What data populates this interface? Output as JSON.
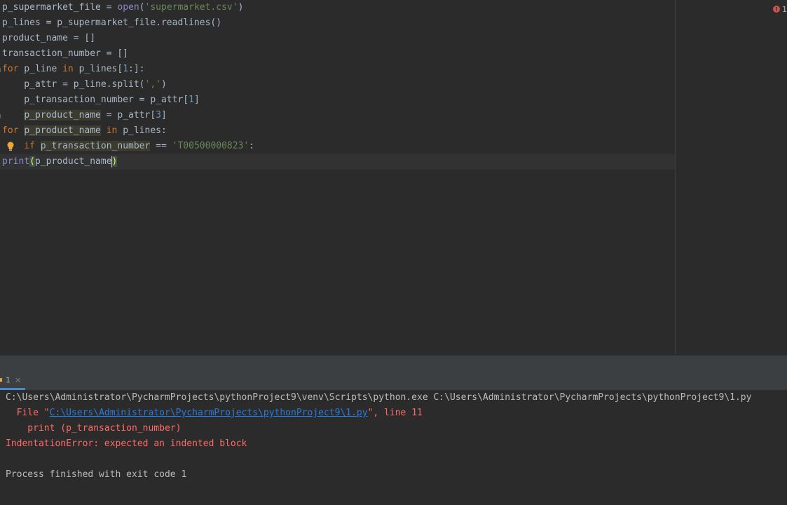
{
  "editor": {
    "error_count": "1",
    "lines": [
      [
        {
          "t": "p_supermarket_file = "
        },
        {
          "t": "open",
          "c": "builtin"
        },
        {
          "t": "("
        },
        {
          "t": "'supermarket.csv'",
          "c": "str"
        },
        {
          "t": ")"
        }
      ],
      [
        {
          "t": "p_lines = p_supermarket_file.readlines()"
        }
      ],
      [
        {
          "t": "product_name = []"
        }
      ],
      [
        {
          "t": "transaction_number = []"
        }
      ],
      [
        {
          "t": "for",
          "c": "kw"
        },
        {
          "t": " p_line "
        },
        {
          "t": "in",
          "c": "kw"
        },
        {
          "t": " p_lines["
        },
        {
          "t": "1",
          "c": "num"
        },
        {
          "t": ":]:"
        }
      ],
      [
        {
          "t": "    p_attr = p_line.split("
        },
        {
          "t": "','",
          "c": "str"
        },
        {
          "t": ")"
        }
      ],
      [
        {
          "t": "    p_transaction_number = p_attr["
        },
        {
          "t": "1",
          "c": "num"
        },
        {
          "t": "]"
        }
      ],
      [
        {
          "t": "    "
        },
        {
          "t": "p_product_name",
          "c": "hl"
        },
        {
          "t": " = p_attr["
        },
        {
          "t": "3",
          "c": "num"
        },
        {
          "t": "]"
        }
      ],
      [
        {
          "t": "for",
          "c": "kw"
        },
        {
          "t": " "
        },
        {
          "t": "p_product_name",
          "c": "hl"
        },
        {
          "t": " "
        },
        {
          "t": "in",
          "c": "kw"
        },
        {
          "t": " p_lines:"
        }
      ],
      [
        {
          "t": "    "
        },
        {
          "t": "if",
          "c": "kw"
        },
        {
          "t": " "
        },
        {
          "t": "p_transaction_number",
          "c": "hl"
        },
        {
          "t": " == "
        },
        {
          "t": "'T00500000823'",
          "c": "str"
        },
        {
          "t": ":",
          "c": "squiggle"
        }
      ],
      [
        {
          "t": "print",
          "c": "builtin"
        },
        {
          "t": "(",
          "c": "brace"
        },
        {
          "t": "p_product_name"
        },
        {
          "t": ")",
          "c": "brace"
        }
      ]
    ]
  },
  "run_panel": {
    "tab_label": "1",
    "tab_close": "×"
  },
  "console": {
    "command": "C:\\Users\\Administrator\\PycharmProjects\\pythonProject9\\venv\\Scripts\\python.exe C:\\Users\\Administrator\\PycharmProjects\\pythonProject9\\1.py",
    "trace_prefix": "  File \"",
    "trace_link": "C:\\Users\\Administrator\\PycharmProjects\\pythonProject9\\1.py",
    "trace_suffix": "\", line 11",
    "trace_code": "    print (p_transaction_number)",
    "error": "IndentationError: expected an indented block",
    "finished": "Process finished with exit code 1"
  }
}
